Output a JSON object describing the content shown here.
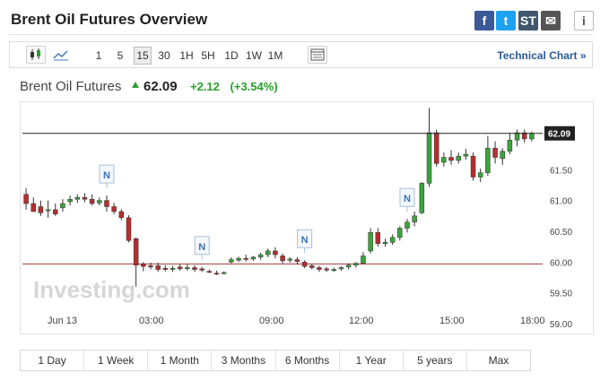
{
  "header": {
    "title": "Brent Oil Futures Overview"
  },
  "share": [
    {
      "name": "facebook-icon",
      "label": "f",
      "color": "#3b5998"
    },
    {
      "name": "twitter-icon",
      "label": "t",
      "color": "#1da1f2"
    },
    {
      "name": "stocktwits-icon",
      "label": "ST",
      "color": "#40576d"
    },
    {
      "name": "email-icon",
      "label": "✉",
      "color": "#555555"
    },
    {
      "name": "info-icon",
      "label": "i",
      "color": "#ffffff"
    }
  ],
  "toolbar": {
    "intervals": [
      "1",
      "5",
      "15",
      "30",
      "1H",
      "5H",
      "1D",
      "1W",
      "1M"
    ],
    "selected_interval": "15",
    "technical_chart_label": "Technical Chart »"
  },
  "quote": {
    "name": "Brent Oil Futures",
    "price": "62.09",
    "change": "+2.12",
    "change_pct": "(+3.54%)"
  },
  "chart_data": {
    "type": "candlestick",
    "x_labels": [
      "Jun 13",
      "03:00",
      "09:00",
      "12:00",
      "15:00",
      "18:00"
    ],
    "y_ticks": [
      "61.50",
      "61.00",
      "60.50",
      "60.00",
      "59.50",
      "59.00"
    ],
    "last_price_label": "62.09",
    "ylim": [
      59.0,
      62.45
    ],
    "previous_close": 59.97,
    "watermark": "Investing.com",
    "news_markers": [
      "N",
      "N",
      "N",
      "N"
    ],
    "candles": [
      [
        61.1,
        61.2,
        60.95,
        60.85
      ],
      [
        60.95,
        61.05,
        60.82,
        60.9
      ],
      [
        60.9,
        61.0,
        60.8,
        60.75
      ],
      [
        60.85,
        61.0,
        60.85,
        60.72
      ],
      [
        60.85,
        60.95,
        60.78,
        60.75
      ],
      [
        60.88,
        61.02,
        60.95,
        60.82
      ],
      [
        60.98,
        61.08,
        61.02,
        60.92
      ],
      [
        61.02,
        61.1,
        61.05,
        60.96
      ],
      [
        61.05,
        61.12,
        61.02,
        60.97
      ],
      [
        61.02,
        61.1,
        60.95,
        60.92
      ],
      [
        60.96,
        61.05,
        61.0,
        60.92
      ],
      [
        61.0,
        61.08,
        60.9,
        60.82
      ],
      [
        60.9,
        60.96,
        60.82,
        60.78
      ],
      [
        60.82,
        60.86,
        60.72,
        60.68
      ],
      [
        60.72,
        60.76,
        60.35,
        60.32
      ],
      [
        60.38,
        60.4,
        59.95,
        59.6
      ],
      [
        59.97,
        60.0,
        59.93,
        59.85
      ],
      [
        59.94,
        59.99,
        59.92,
        59.88
      ],
      [
        59.94,
        59.99,
        59.88,
        59.84
      ],
      [
        59.9,
        59.95,
        59.88,
        59.85
      ],
      [
        59.88,
        59.94,
        59.9,
        59.84
      ],
      [
        59.92,
        59.96,
        59.89,
        59.86
      ],
      [
        59.9,
        59.96,
        59.91,
        59.86
      ],
      [
        59.91,
        59.95,
        59.88,
        59.84
      ],
      [
        59.89,
        59.92,
        59.87,
        59.84
      ],
      [
        59.85,
        59.88,
        59.84,
        59.82
      ],
      [
        59.82,
        59.86,
        59.81,
        59.79
      ],
      [
        59.82,
        59.85,
        59.83,
        59.8
      ],
      [
        60.0,
        60.08,
        60.04,
        59.98
      ],
      [
        60.03,
        60.09,
        60.06,
        60.0
      ],
      [
        60.06,
        60.12,
        60.05,
        60.01
      ],
      [
        60.05,
        60.1,
        60.08,
        60.02
      ],
      [
        60.08,
        60.15,
        60.12,
        60.04
      ],
      [
        60.12,
        60.22,
        60.18,
        60.08
      ],
      [
        60.18,
        60.24,
        60.12,
        60.06
      ],
      [
        60.1,
        60.14,
        60.02,
        59.98
      ],
      [
        60.03,
        60.08,
        60.05,
        59.99
      ],
      [
        60.04,
        60.08,
        60.01,
        59.96
      ],
      [
        60.0,
        60.03,
        59.93,
        59.9
      ],
      [
        59.94,
        59.97,
        59.91,
        59.88
      ],
      [
        59.91,
        59.94,
        59.88,
        59.84
      ],
      [
        59.89,
        59.92,
        59.87,
        59.84
      ],
      [
        59.87,
        59.91,
        59.88,
        59.84
      ],
      [
        59.89,
        59.93,
        59.91,
        59.86
      ],
      [
        59.92,
        59.98,
        59.95,
        59.88
      ],
      [
        59.95,
        60.0,
        59.98,
        59.91
      ],
      [
        59.98,
        60.16,
        60.1,
        59.96
      ],
      [
        60.18,
        60.55,
        60.48,
        60.14
      ],
      [
        60.48,
        60.55,
        60.3,
        60.25
      ],
      [
        60.3,
        60.38,
        60.32,
        60.25
      ],
      [
        60.32,
        60.45,
        60.4,
        60.28
      ],
      [
        60.4,
        60.58,
        60.55,
        60.35
      ],
      [
        60.55,
        60.7,
        60.65,
        60.48
      ],
      [
        60.65,
        60.82,
        60.75,
        60.58
      ],
      [
        60.8,
        61.3,
        61.28,
        60.78
      ],
      [
        61.28,
        62.5,
        62.1,
        61.22
      ],
      [
        62.1,
        62.15,
        61.6,
        61.55
      ],
      [
        61.62,
        61.78,
        61.7,
        61.55
      ],
      [
        61.7,
        61.82,
        61.65,
        61.58
      ],
      [
        61.65,
        61.78,
        61.72,
        61.6
      ],
      [
        61.72,
        61.84,
        61.75,
        61.66
      ],
      [
        61.72,
        61.78,
        61.38,
        61.32
      ],
      [
        61.38,
        61.52,
        61.45,
        61.3
      ],
      [
        61.45,
        62.05,
        61.85,
        61.4
      ],
      [
        61.85,
        61.96,
        61.7,
        61.6
      ],
      [
        61.68,
        61.85,
        61.8,
        61.58
      ],
      [
        61.8,
        62.1,
        61.98,
        61.75
      ],
      [
        61.98,
        62.15,
        62.1,
        61.88
      ],
      [
        62.1,
        62.15,
        62.0,
        61.94
      ],
      [
        62.0,
        62.12,
        62.09,
        61.96
      ]
    ]
  },
  "ranges": [
    "1 Day",
    "1 Week",
    "1 Month",
    "3 Months",
    "6 Months",
    "1 Year",
    "5 years",
    "Max"
  ]
}
